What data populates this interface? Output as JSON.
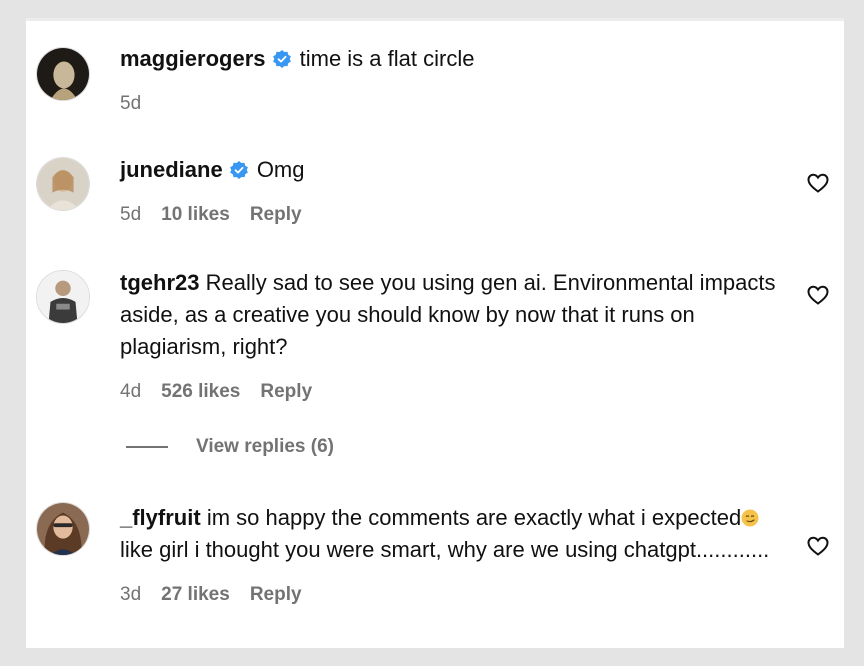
{
  "comments": [
    {
      "username": "maggierogers",
      "verified": true,
      "text": "time is a flat circle",
      "time": "5d",
      "likes": "",
      "reply_label": ""
    },
    {
      "username": "junediane",
      "verified": true,
      "text": "Omg",
      "time": "5d",
      "likes": "10 likes",
      "reply_label": "Reply"
    },
    {
      "username": "tgehr23",
      "verified": false,
      "text": "Really sad to see you using gen ai. Environmental impacts aside, as a creative you should know by now that it runs on plagiarism, right?",
      "time": "4d",
      "likes": "526 likes",
      "reply_label": "Reply"
    },
    {
      "username": "_flyfruit",
      "verified": false,
      "text_before_emoji": "im so happy the comments are exactly what i expected",
      "emoji": "smirk-emoji",
      "text_after_emoji": " like girl i thought you were smart, why are we using chatgpt............",
      "time": "3d",
      "likes": "27 likes",
      "reply_label": "Reply"
    }
  ],
  "view_replies": "View replies (6)",
  "icons": {
    "verified": "verified-badge-icon",
    "like": "heart-outline-icon"
  },
  "colors": {
    "verified_blue": "#3897f0",
    "muted_text": "#737373",
    "background": "#e4e4e4"
  }
}
